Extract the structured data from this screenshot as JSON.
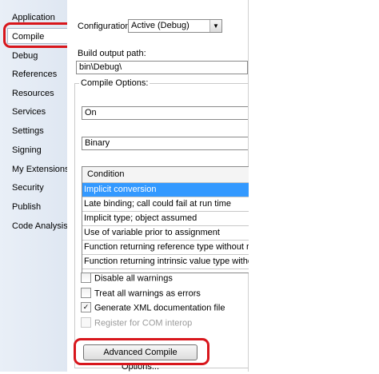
{
  "sidebar": {
    "items": [
      {
        "label": "Application"
      },
      {
        "label": "Compile"
      },
      {
        "label": "Debug"
      },
      {
        "label": "References"
      },
      {
        "label": "Resources"
      },
      {
        "label": "Services"
      },
      {
        "label": "Settings"
      },
      {
        "label": "Signing"
      },
      {
        "label": "My Extensions"
      },
      {
        "label": "Security"
      },
      {
        "label": "Publish"
      },
      {
        "label": "Code Analysis"
      }
    ],
    "selected": "Compile"
  },
  "config": {
    "label": "Configuration:",
    "value": "Active (Debug)"
  },
  "output": {
    "label": "Build output path:",
    "value": "bin\\Debug\\"
  },
  "compile_options": {
    "label": "Compile Options:",
    "option1_value": "On",
    "option2_value": "Binary"
  },
  "grid": {
    "header": "Condition",
    "rows": [
      "Implicit conversion",
      "Late binding; call could fail at run time",
      "Implicit type; object assumed",
      "Use of variable prior to assignment",
      "Function returning reference type without return value",
      "Function returning intrinsic value type without return value"
    ]
  },
  "checkboxes": {
    "disable_warnings": {
      "label": "Disable all warnings",
      "checked": false
    },
    "treat_errors": {
      "label": "Treat all warnings as errors",
      "checked": false
    },
    "gen_xml": {
      "label": "Generate XML documentation file",
      "checked": true
    },
    "register_com": {
      "label": "Register for COM interop",
      "checked": false,
      "enabled": false
    }
  },
  "buttons": {
    "advanced": "Advanced Compile Options..."
  },
  "colors": {
    "highlight": "#d8161c",
    "selection": "#3399ff"
  }
}
